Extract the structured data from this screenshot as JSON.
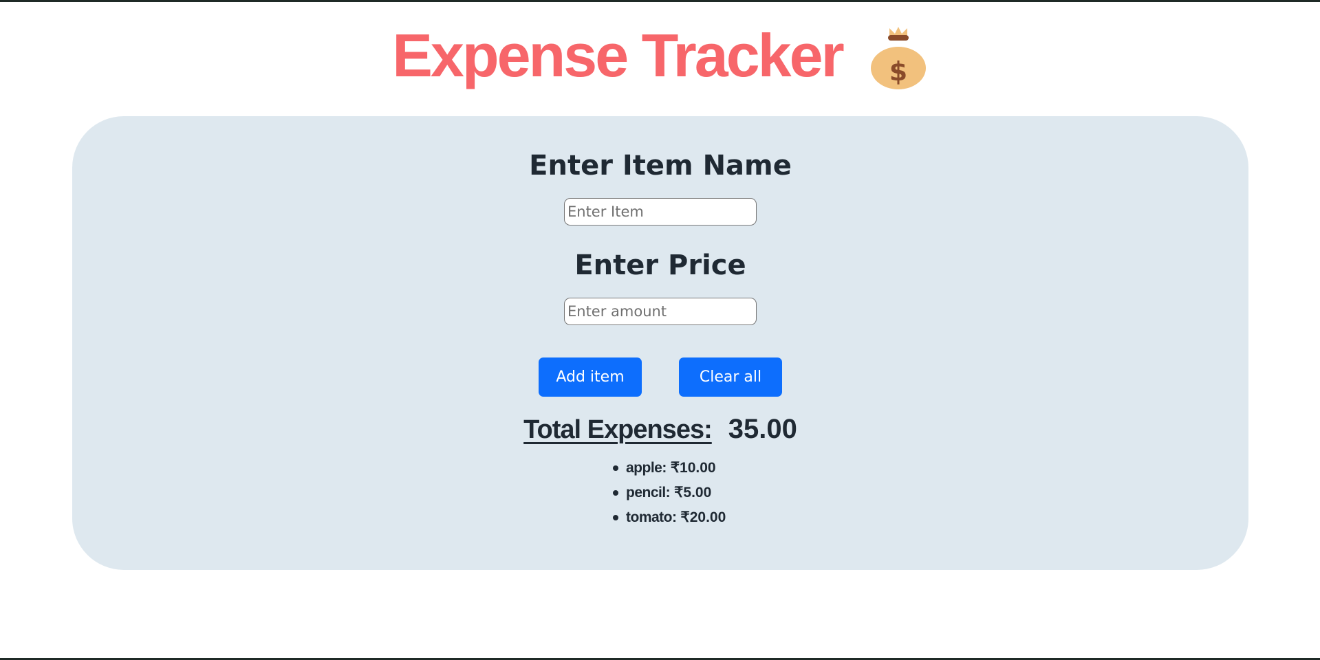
{
  "header": {
    "title": "Expense Tracker",
    "icon": "moneybag-icon",
    "title_color": "#f7666a"
  },
  "form": {
    "item_heading": "Enter Item Name",
    "item_placeholder": "Enter Item",
    "item_value": "",
    "price_heading": "Enter Price",
    "price_placeholder": "Enter amount",
    "price_value": "",
    "add_label": "Add item",
    "clear_label": "Clear all",
    "button_color": "#0d6efd"
  },
  "summary": {
    "total_label": "Total Expenses:",
    "total_value": "35.00"
  },
  "expenses": [
    {
      "name": "apple:",
      "amount": "₹10.00"
    },
    {
      "name": "pencil:",
      "amount": "₹5.00"
    },
    {
      "name": "tomato:",
      "amount": "₹20.00"
    }
  ],
  "colors": {
    "card_background": "#dee8ef",
    "text": "#1f2933"
  }
}
